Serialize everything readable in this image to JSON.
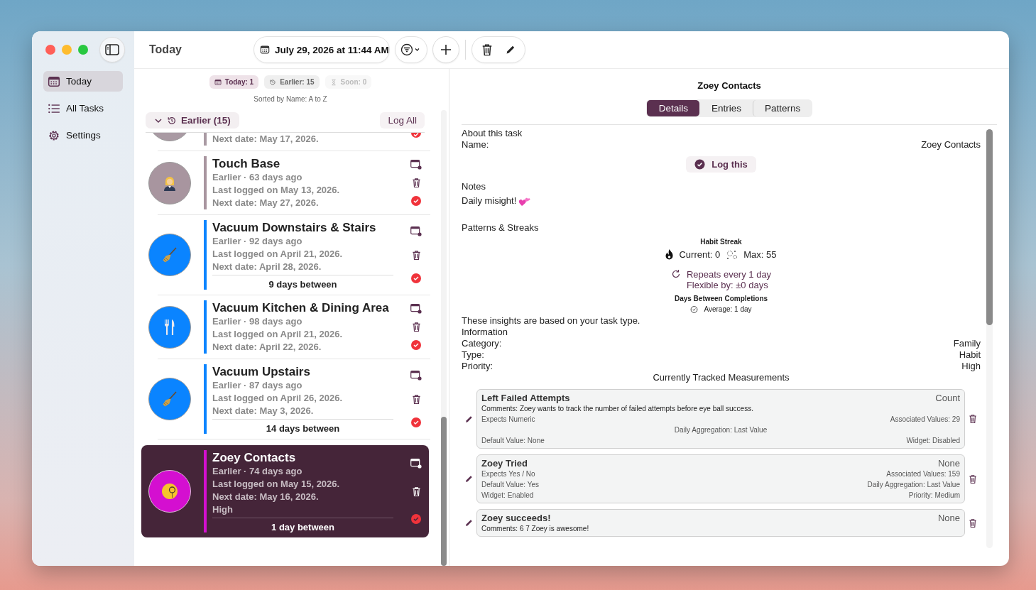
{
  "window": {
    "title": "Today"
  },
  "sidebar": {
    "items": [
      {
        "label": "Today",
        "selected": true
      },
      {
        "label": "All Tasks",
        "selected": false
      },
      {
        "label": "Settings",
        "selected": false
      }
    ]
  },
  "toolbar": {
    "date": "July 29, 2026 at 11:44 AM"
  },
  "filters": [
    {
      "label": "Today: 1",
      "selected": true,
      "disabled": false
    },
    {
      "label": "Earlier: 15",
      "selected": false,
      "disabled": false
    },
    {
      "label": "Soon: 0",
      "selected": false,
      "disabled": true
    }
  ],
  "sort_label": "Sorted by Name: A to Z",
  "section": {
    "title": "Earlier (15)",
    "expanded": true,
    "action": "Log All"
  },
  "tasks": [
    {
      "kind": "partial",
      "next_date": "Next date: May 17, 2026.",
      "color": "#a99aa3",
      "selected": false
    },
    {
      "kind": "full",
      "title": "Touch Base",
      "color": "#a8959f",
      "status": "Earlier · 63 days ago",
      "last_logged": "Last logged on May 13, 2026.",
      "next_date": "Next date: May 27, 2026.",
      "selected": false
    },
    {
      "kind": "full",
      "title": "Vacuum Downstairs & Stairs",
      "color": "#0a84ff",
      "status": "Earlier · 92 days ago",
      "last_logged": "Last logged on April 21, 2026.",
      "next_date": "Next date: April 28, 2026.",
      "between": "9 days between",
      "selected": false
    },
    {
      "kind": "full",
      "title": "Vacuum Kitchen & Dining Area",
      "color": "#0a84ff",
      "status": "Earlier · 98 days ago",
      "last_logged": "Last logged on April 21, 2026.",
      "next_date": "Next date: April 22, 2026.",
      "selected": false
    },
    {
      "kind": "full",
      "title": "Vacuum Upstairs",
      "color": "#0a84ff",
      "status": "Earlier · 87 days ago",
      "last_logged": "Last logged on April 26, 2026.",
      "next_date": "Next date: May 3, 2026.",
      "between": "14 days between",
      "selected": false
    },
    {
      "kind": "full",
      "title": "Zoey Contacts",
      "color": "#d40fd0",
      "status": "Earlier · 74 days ago",
      "last_logged": "Last logged on May 15, 2026.",
      "next_date": "Next date: May 16, 2026.",
      "priority": "High",
      "between": "1 day between",
      "selected": true
    }
  ],
  "detail": {
    "title": "Zoey Contacts",
    "tabs": [
      {
        "label": "Details",
        "selected": true
      },
      {
        "label": "Entries",
        "selected": false
      },
      {
        "label": "Patterns",
        "selected": false
      }
    ],
    "about": {
      "heading": "About this task",
      "name_label": "Name:",
      "name_value": "Zoey Contacts"
    },
    "log_button": "Log this",
    "notes": {
      "heading": "Notes",
      "text": "Daily misight!"
    },
    "patterns": {
      "heading": "Patterns & Streaks",
      "streak_title": "Habit Streak",
      "current": "Current: 0",
      "max": "Max: 55",
      "repeats": "Repeats every 1 day",
      "flexible": "Flexible by: ±0 days",
      "between_title": "Days Between Completions",
      "average": "Average: 1 day",
      "insight": "These insights are based on your task type."
    },
    "information": {
      "heading": "Information",
      "rows": [
        {
          "label": "Category:",
          "value": "Family"
        },
        {
          "label": "Type:",
          "value": "Habit"
        },
        {
          "label": "Priority:",
          "value": "High"
        }
      ]
    },
    "measurements": {
      "heading": "Currently Tracked Measurements",
      "items": [
        {
          "name": "Left Failed Attempts",
          "unit": "Count",
          "rows": [
            {
              "kind": "comment",
              "text": "Comments: Zoey wants to track the number of failed attempts before eye ball success."
            },
            {
              "kind": "pair",
              "left": "Expects Numeric",
              "right": "Associated Values: 29"
            },
            {
              "kind": "center",
              "text": "Daily Aggregation: Last Value"
            },
            {
              "kind": "pair",
              "left": "Default Value: None",
              "right": "Widget: Disabled"
            }
          ]
        },
        {
          "name": "Zoey Tried",
          "unit": "None",
          "rows": [
            {
              "kind": "pair",
              "left": "Expects Yes / No",
              "right": "Associated Values: 159"
            },
            {
              "kind": "pair",
              "left": "Default Value: Yes",
              "right": "Daily Aggregation: Last Value"
            },
            {
              "kind": "pair",
              "left": "Widget: Enabled",
              "right": "Priority: Medium"
            }
          ]
        },
        {
          "name": "Zoey succeeds!",
          "unit": "None",
          "rows": [
            {
              "kind": "comment",
              "text": "Comments: 6 7 Zoey is awesome!"
            }
          ]
        }
      ]
    }
  }
}
